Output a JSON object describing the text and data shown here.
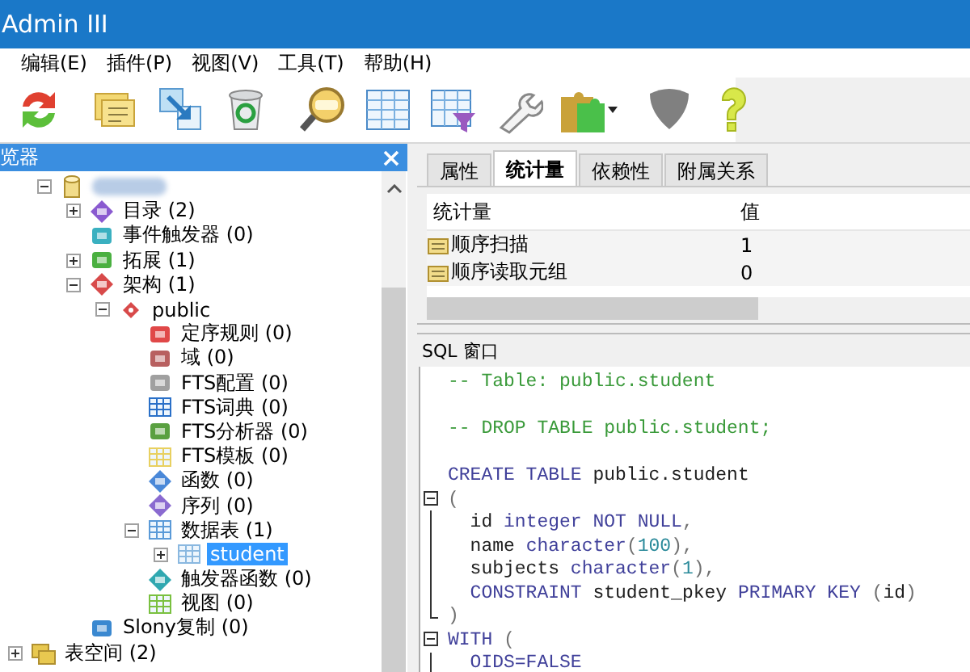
{
  "window": {
    "title": "Admin III"
  },
  "menu": [
    "编辑(E)",
    "插件(P)",
    "视图(V)",
    "工具(T)",
    "帮助(H)"
  ],
  "toolbar": [
    {
      "kind": "refresh",
      "disabled": false
    },
    {
      "kind": "separator"
    },
    {
      "kind": "properties",
      "disabled": false
    },
    {
      "kind": "create",
      "disabled": false
    },
    {
      "kind": "delete",
      "disabled": false
    },
    {
      "kind": "separator"
    },
    {
      "kind": "sql",
      "disabled": false
    },
    {
      "kind": "view-data",
      "disabled": false
    },
    {
      "kind": "filter-data",
      "disabled": false
    },
    {
      "kind": "maintenance",
      "disabled": false
    },
    {
      "kind": "plugins",
      "disabled": false
    },
    {
      "kind": "separator"
    },
    {
      "kind": "guru",
      "disabled": true
    },
    {
      "kind": "help",
      "disabled": false
    }
  ],
  "browser": {
    "title": "览器",
    "tree": [
      {
        "kind": "offscreen",
        "children": [
          {
            "kind": "database",
            "expanded": true,
            "selected": false,
            "children": [
              {
                "kind": "catalog",
                "label": "目录 (2)",
                "expanded": false,
                "selected": false
              },
              {
                "kind": "event-trigger",
                "label": "事件触发器 (0)",
                "selected": false
              },
              {
                "kind": "extension",
                "label": "拓展 (1)",
                "expanded": false,
                "selected": false
              },
              {
                "kind": "schemas",
                "label": "架构 (1)",
                "expanded": true,
                "selected": false,
                "children": [
                  {
                    "kind": "schema",
                    "label": "public",
                    "expanded": true,
                    "selected": false,
                    "children": [
                      {
                        "kind": "collation",
                        "label": "定序规则 (0)",
                        "selected": false
                      },
                      {
                        "kind": "domain",
                        "label": "域 (0)",
                        "selected": false
                      },
                      {
                        "kind": "fts-config",
                        "label": "FTS配置 (0)",
                        "selected": false
                      },
                      {
                        "kind": "fts-dictionary",
                        "label": "FTS词典 (0)",
                        "selected": false
                      },
                      {
                        "kind": "fts-parser",
                        "label": "FTS分析器 (0)",
                        "selected": false
                      },
                      {
                        "kind": "fts-template",
                        "label": "FTS模板 (0)",
                        "selected": false
                      },
                      {
                        "kind": "functions",
                        "label": "函数 (0)",
                        "selected": false
                      },
                      {
                        "kind": "sequences",
                        "label": "序列 (0)",
                        "selected": false
                      },
                      {
                        "kind": "tables",
                        "label": "数据表 (1)",
                        "expanded": true,
                        "selected": false,
                        "children": [
                          {
                            "kind": "table",
                            "label": "student",
                            "expanded": false,
                            "selected": true
                          }
                        ]
                      },
                      {
                        "kind": "trigger-functions",
                        "label": "触发器函数 (0)",
                        "selected": false
                      },
                      {
                        "kind": "views",
                        "label": "视图 (0)",
                        "selected": false
                      }
                    ]
                  }
                ]
              },
              {
                "kind": "replication",
                "label": "Slony复制 (0)",
                "selected": false
              }
            ]
          }
        ]
      },
      {
        "kind": "tablespaces",
        "label": "表空间 (2)",
        "expanded": false,
        "selected": false
      }
    ]
  },
  "properties": {
    "tabs": [
      {
        "label": "属性",
        "selected": false
      },
      {
        "label": "统计量",
        "selected": true
      },
      {
        "label": "依赖性",
        "selected": false
      },
      {
        "label": "附属关系",
        "selected": false
      }
    ],
    "columns": [
      "统计量",
      "值"
    ],
    "rows": [
      {
        "kind": "counter",
        "cells": [
          "顺序扫描",
          "1"
        ]
      },
      {
        "kind": "counter",
        "cells": [
          "顺序读取元组",
          "0"
        ]
      }
    ]
  },
  "sql_pane": {
    "title": "SQL 窗口",
    "lines": [
      {
        "kind": "code",
        "tokens": [
          {
            "kind": "comment",
            "text": "-- Table: public.student"
          }
        ]
      },
      {
        "kind": "blank"
      },
      {
        "kind": "code",
        "tokens": [
          {
            "kind": "comment",
            "text": "-- DROP TABLE public.student;"
          }
        ]
      },
      {
        "kind": "blank"
      },
      {
        "kind": "code",
        "tokens": [
          {
            "kind": "keyword",
            "text": "CREATE TABLE"
          },
          {
            "kind": "identifier",
            "text": " public.student"
          }
        ]
      },
      {
        "kind": "fold-open",
        "tokens": [
          {
            "kind": "punct",
            "text": "("
          }
        ]
      },
      {
        "kind": "fold-bar",
        "tokens": [
          {
            "kind": "identifier",
            "text": "  id "
          },
          {
            "kind": "keyword",
            "text": "integer NOT NULL"
          },
          {
            "kind": "punct",
            "text": ","
          }
        ]
      },
      {
        "kind": "fold-bar",
        "tokens": [
          {
            "kind": "identifier",
            "text": "  name "
          },
          {
            "kind": "keyword",
            "text": "character"
          },
          {
            "kind": "punct",
            "text": "("
          },
          {
            "kind": "number",
            "text": "100"
          },
          {
            "kind": "punct",
            "text": "),"
          }
        ]
      },
      {
        "kind": "fold-bar",
        "tokens": [
          {
            "kind": "identifier",
            "text": "  subjects "
          },
          {
            "kind": "keyword",
            "text": "character"
          },
          {
            "kind": "punct",
            "text": "("
          },
          {
            "kind": "number",
            "text": "1"
          },
          {
            "kind": "punct",
            "text": "),"
          }
        ]
      },
      {
        "kind": "fold-bar",
        "tokens": [
          {
            "kind": "keyword",
            "text": "  CONSTRAINT"
          },
          {
            "kind": "identifier",
            "text": " student_pkey "
          },
          {
            "kind": "keyword",
            "text": "PRIMARY KEY"
          },
          {
            "kind": "punct",
            "text": " ("
          },
          {
            "kind": "identifier",
            "text": "id"
          },
          {
            "kind": "punct",
            "text": ")"
          }
        ]
      },
      {
        "kind": "fold-end",
        "tokens": [
          {
            "kind": "punct",
            "text": ")"
          }
        ]
      },
      {
        "kind": "fold-open",
        "tokens": [
          {
            "kind": "keyword",
            "text": "WITH"
          },
          {
            "kind": "punct",
            "text": " ("
          }
        ]
      },
      {
        "kind": "fold-bar",
        "tokens": [
          {
            "kind": "keyword",
            "text": "  OIDS=FALSE"
          }
        ]
      }
    ]
  }
}
